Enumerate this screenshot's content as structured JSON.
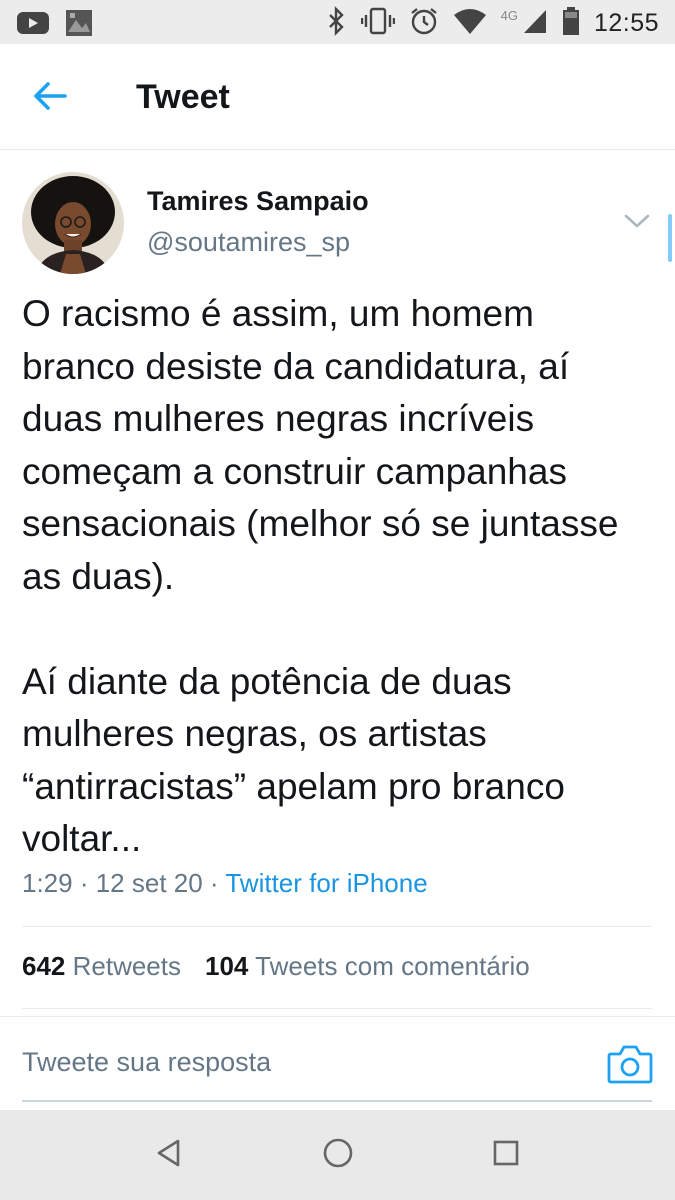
{
  "status_bar": {
    "time": "12:55",
    "network": "4G",
    "icons": [
      "youtube-icon",
      "photo-icon",
      "bluetooth-icon",
      "vibrate-icon",
      "alarm-icon",
      "wifi-icon",
      "signal-icon",
      "battery-icon"
    ]
  },
  "header": {
    "title": "Tweet",
    "back_icon": "arrow-left-icon"
  },
  "tweet": {
    "author_name": "Tamires Sampaio",
    "author_handle": "@soutamires_sp",
    "paragraph_1": "O racismo é assim, um homem branco desiste da candidatura, aí duas mulheres negras incríveis começam a construir campanhas sensacionais (melhor só se juntasse as duas).",
    "paragraph_2": "Aí diante da potência de duas mulheres negras, os artistas “antirracistas” apelam pro branco voltar...",
    "time": "1:29",
    "date": "12 set 20",
    "separator": " · ",
    "source": "Twitter for iPhone"
  },
  "stats": {
    "retweets_count": "642",
    "retweets_label": " Retweets",
    "quotes_count": "104",
    "quotes_label": " Tweets com comentário"
  },
  "reply": {
    "placeholder": "Tweete sua resposta",
    "camera_icon": "camera-icon"
  },
  "colors": {
    "accent": "#1da1f2",
    "link": "#1b95e0",
    "secondary_text": "#657786",
    "primary_text": "#14171a",
    "divider": "#e6ecf0"
  }
}
